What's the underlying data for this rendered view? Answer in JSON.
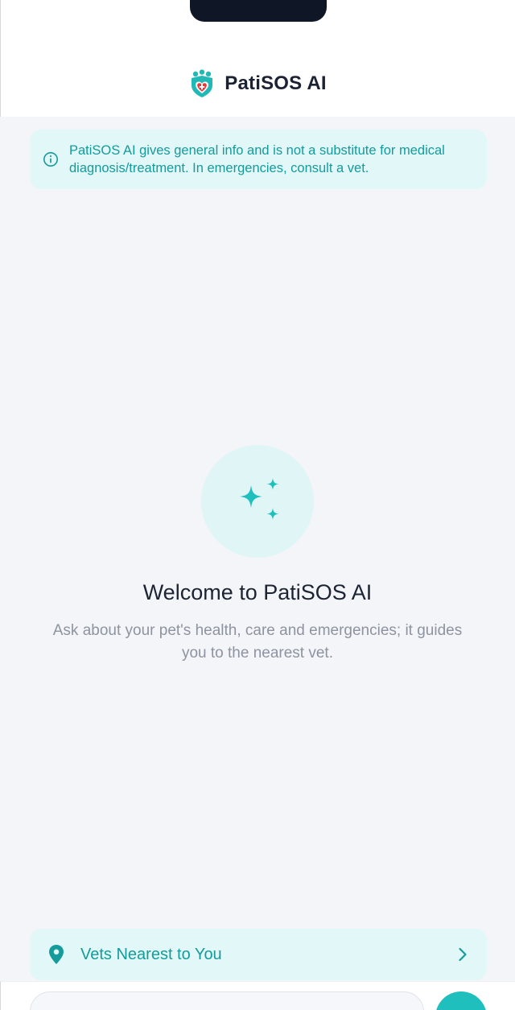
{
  "app": {
    "title": "PatiSOS AI",
    "logo_icon": "paw-shield-medical-icon"
  },
  "disclaimer": {
    "icon": "info-icon",
    "text": "PatiSOS AI gives general info and is not a substitute for medical diagnosis/treatment. In emergencies, consult a vet."
  },
  "welcome": {
    "icon": "sparkles-icon",
    "title": "Welcome to PatiSOS AI",
    "subtitle": "Ask about your pet's health, care and emergencies; it guides you to the nearest vet."
  },
  "vets": {
    "icon": "map-pin-icon",
    "label": "Vets Nearest to You",
    "chevron": "chevron-right-icon"
  },
  "composer": {
    "input_value": "",
    "send_icon": "send-icon"
  },
  "colors": {
    "accent": "#1fbfbd",
    "accent_text": "#149b9c",
    "accent_bg": "#e2f7f7",
    "background": "#f3f5f9",
    "brand_red": "#e23b3b"
  }
}
